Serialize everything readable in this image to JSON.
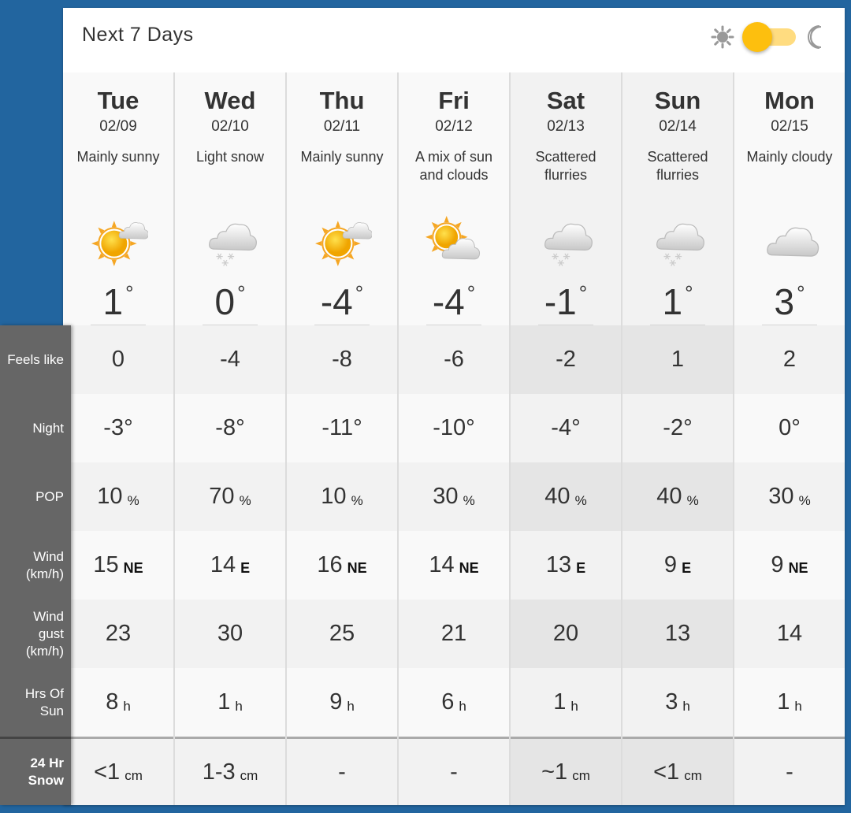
{
  "header": {
    "title": "Next 7 Days",
    "theme_toggle": {
      "left_icon": "sun-icon",
      "right_icon": "moon-icon",
      "state": "light",
      "accent": "#fdbf0e"
    }
  },
  "row_labels": {
    "feels_like": "Feels like",
    "night": "Night",
    "pop": "POP",
    "wind": "Wind\n(km/h)",
    "wind_gust": "Wind\ngust\n(km/h)",
    "hrs_sun": "Hrs Of\nSun",
    "snow": "24 Hr\nSnow"
  },
  "units": {
    "temp": "°",
    "pop": "%",
    "sun": "h",
    "snow": "cm"
  },
  "days": [
    {
      "name": "Tue",
      "date": "02/09",
      "condition": "Mainly sunny",
      "icon": "sun-cloud-icon",
      "temp": "1",
      "feels_like": "0",
      "night": "-3",
      "pop": "10",
      "wind": "15",
      "wind_dir": "NE",
      "gust": "23",
      "sun": "8",
      "snow": "<1",
      "snow_unit": "cm",
      "weekend": false
    },
    {
      "name": "Wed",
      "date": "02/10",
      "condition": "Light snow",
      "icon": "cloud-snow-icon",
      "temp": "0",
      "feels_like": "-4",
      "night": "-8",
      "pop": "70",
      "wind": "14",
      "wind_dir": "E",
      "gust": "30",
      "sun": "1",
      "snow": "1-3",
      "snow_unit": "cm",
      "weekend": false
    },
    {
      "name": "Thu",
      "date": "02/11",
      "condition": "Mainly sunny",
      "icon": "sun-cloud-icon",
      "temp": "-4",
      "feels_like": "-8",
      "night": "-11",
      "pop": "10",
      "wind": "16",
      "wind_dir": "NE",
      "gust": "25",
      "sun": "9",
      "snow": "-",
      "snow_unit": "",
      "weekend": false
    },
    {
      "name": "Fri",
      "date": "02/12",
      "condition": "A mix of sun and clouds",
      "icon": "sun-behind-cloud-icon",
      "temp": "-4",
      "feels_like": "-6",
      "night": "-10",
      "pop": "30",
      "wind": "14",
      "wind_dir": "NE",
      "gust": "21",
      "sun": "6",
      "snow": "-",
      "snow_unit": "",
      "weekend": false
    },
    {
      "name": "Sat",
      "date": "02/13",
      "condition": "Scattered flurries",
      "icon": "cloud-snow-icon",
      "temp": "-1",
      "feels_like": "-2",
      "night": "-4",
      "pop": "40",
      "wind": "13",
      "wind_dir": "E",
      "gust": "20",
      "sun": "1",
      "snow": "~1",
      "snow_unit": "cm",
      "weekend": true
    },
    {
      "name": "Sun",
      "date": "02/14",
      "condition": "Scattered flurries",
      "icon": "cloud-snow-icon",
      "temp": "1",
      "feels_like": "1",
      "night": "-2",
      "pop": "40",
      "wind": "9",
      "wind_dir": "E",
      "gust": "13",
      "sun": "3",
      "snow": "<1",
      "snow_unit": "cm",
      "weekend": true
    },
    {
      "name": "Mon",
      "date": "02/15",
      "condition": "Mainly cloudy",
      "icon": "cloud-icon",
      "temp": "3",
      "feels_like": "2",
      "night": "0",
      "pop": "30",
      "wind": "9",
      "wind_dir": "NE",
      "gust": "14",
      "sun": "1",
      "snow": "-",
      "snow_unit": "",
      "weekend": false
    }
  ]
}
